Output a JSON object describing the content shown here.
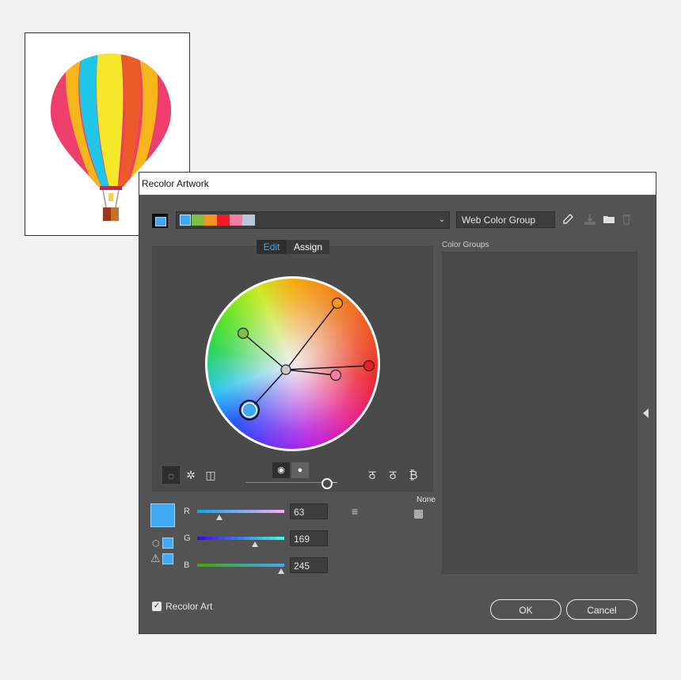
{
  "dialog": {
    "title": "Recolor Artwork"
  },
  "topbar": {
    "group_colors": [
      "#3fa9f5",
      "#7cc242",
      "#f7931e",
      "#ee1c25",
      "#f77ea4",
      "#b7c8d4"
    ],
    "group_name": "Web Color Group",
    "icons": [
      "eyedropper-icon",
      "save-changes-icon",
      "new-folder-icon",
      "trash-icon"
    ]
  },
  "tabs": [
    {
      "label": "Edit",
      "active": true
    },
    {
      "label": "Assign",
      "active": false
    }
  ],
  "channels": [
    {
      "label": "R",
      "value": "63",
      "fraction": 0.247
    },
    {
      "label": "G",
      "value": "169",
      "fraction": 0.663
    },
    {
      "label": "B",
      "value": "245",
      "fraction": 0.961
    }
  ],
  "current_color": "#3fa9f5",
  "none_label": "None",
  "color_groups": {
    "label": "Color Groups"
  },
  "recolor_art": {
    "label": "Recolor Art",
    "checked": true
  },
  "buttons": {
    "ok": "OK",
    "cancel": "Cancel"
  }
}
